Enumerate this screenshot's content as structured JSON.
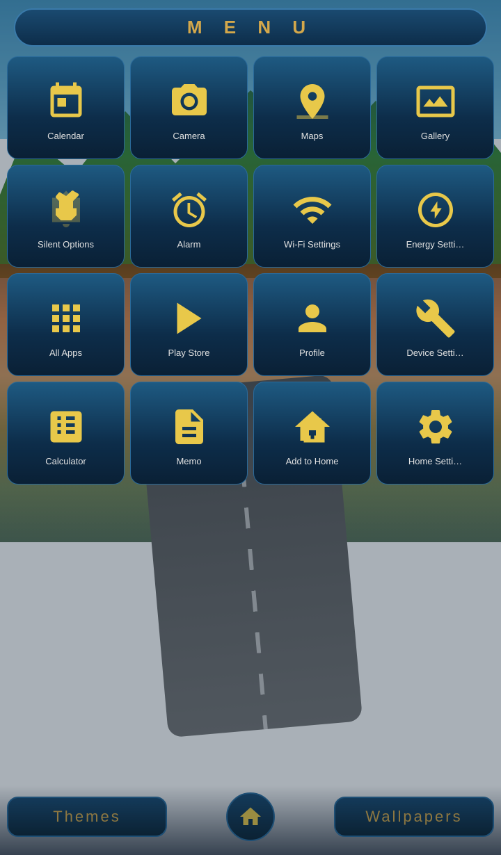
{
  "header": {
    "title": "M E N U"
  },
  "apps": [
    {
      "id": "calendar",
      "label": "Calendar",
      "icon": "calendar"
    },
    {
      "id": "camera",
      "label": "Camera",
      "icon": "camera"
    },
    {
      "id": "maps",
      "label": "Maps",
      "icon": "maps"
    },
    {
      "id": "gallery",
      "label": "Gallery",
      "icon": "gallery"
    },
    {
      "id": "silent-options",
      "label": "Silent Options",
      "icon": "silent"
    },
    {
      "id": "alarm",
      "label": "Alarm",
      "icon": "alarm"
    },
    {
      "id": "wifi-settings",
      "label": "Wi-Fi Settings",
      "icon": "wifi"
    },
    {
      "id": "energy-settings",
      "label": "Energy Setti…",
      "icon": "energy"
    },
    {
      "id": "all-apps",
      "label": "All Apps",
      "icon": "allapps"
    },
    {
      "id": "play-store",
      "label": "Play Store",
      "icon": "playstore"
    },
    {
      "id": "profile",
      "label": "Profile",
      "icon": "profile"
    },
    {
      "id": "device-settings",
      "label": "Device Setti…",
      "icon": "devicesettings"
    },
    {
      "id": "calculator",
      "label": "Calculator",
      "icon": "calculator"
    },
    {
      "id": "memo",
      "label": "Memo",
      "icon": "memo"
    },
    {
      "id": "add-to-home",
      "label": "Add to Home",
      "icon": "addtohome"
    },
    {
      "id": "home-settings",
      "label": "Home Setti…",
      "icon": "homesettings"
    }
  ],
  "bottom": {
    "themes_label": "Themes",
    "wallpapers_label": "Wallpapers"
  }
}
